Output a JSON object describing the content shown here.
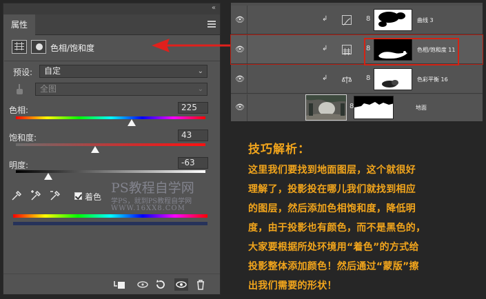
{
  "properties_panel": {
    "collapse_glyph": "«",
    "tab_label": "属性",
    "adjustment_title": "色相/饱和度",
    "preset": {
      "label": "预设:",
      "value": "自定"
    },
    "channel": {
      "value": "全图"
    },
    "hue": {
      "label": "色相:",
      "value": "225"
    },
    "saturation": {
      "label": "饱和度:",
      "value": "43"
    },
    "lightness": {
      "label": "明度:",
      "value": "-63"
    },
    "colorize": {
      "label": "着色",
      "checked": true
    }
  },
  "watermark": {
    "line1": "PS教程自学网",
    "line2": "学PS，就到PS教程自学网",
    "line3": "WWW.16XX8.COM"
  },
  "layers": [
    {
      "name": "曲线 3",
      "type": "curves",
      "visible": true,
      "selected": false
    },
    {
      "name": "色相/饱和度 11",
      "type": "hue-saturation",
      "visible": true,
      "selected": true
    },
    {
      "name": "色彩平衡 16",
      "type": "color-balance",
      "visible": true,
      "selected": false
    },
    {
      "name": "地面",
      "type": "image",
      "visible": true,
      "selected": false
    }
  ],
  "tip": {
    "title": "技巧解析：",
    "lines": [
      "这里我们要找到地面图层，这个就很好",
      "理解了，投影投在哪儿我们就找到相应",
      "的图层，然后添加色相饱和度，降低明",
      "度，由于投影也有颜色，而不是黑色的，",
      "大家要根据所处环境用“着色”的方式给",
      "投影整体添加颜色！然后通过“蒙版”擦",
      "出我们需要的形状！"
    ]
  },
  "colors": {
    "highlight_red": "#d42314",
    "tip_orange": "#f2a51c",
    "panel_gray": "#535353"
  }
}
